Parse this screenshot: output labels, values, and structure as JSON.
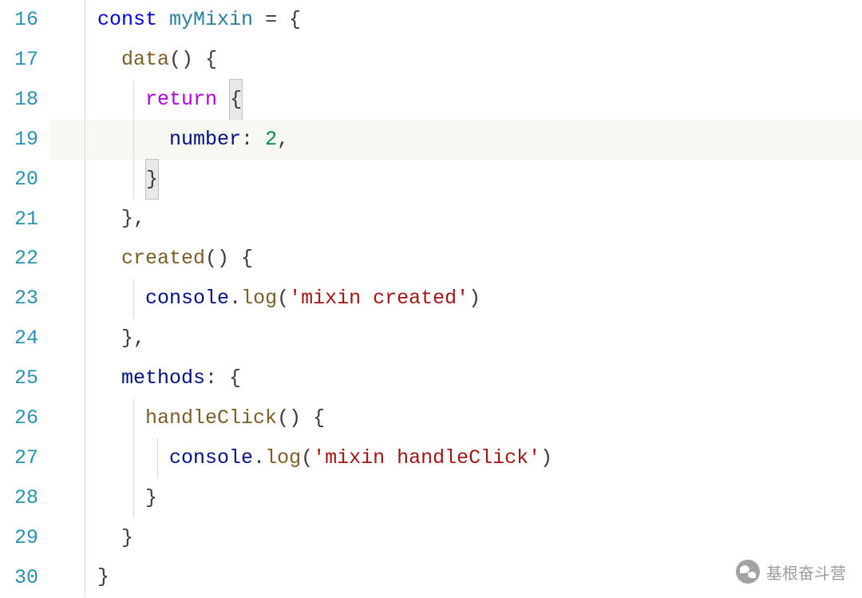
{
  "lineNumbers": [
    "16",
    "17",
    "18",
    "19",
    "20",
    "21",
    "22",
    "23",
    "24",
    "25",
    "26",
    "27",
    "28",
    "29",
    "30"
  ],
  "code": {
    "l16": {
      "kw": "const",
      "name": "myMixin",
      "op": "=",
      "brace": "{"
    },
    "l17": {
      "fn": "data",
      "parens": "()",
      "brace": "{"
    },
    "l18": {
      "kw": "return",
      "brace": "{"
    },
    "l19": {
      "prop": "number",
      "colon": ":",
      "val": "2",
      "comma": ","
    },
    "l20": {
      "brace": "}"
    },
    "l21": {
      "brace": "}",
      "comma": ","
    },
    "l22": {
      "fn": "created",
      "parens": "()",
      "brace": "{"
    },
    "l23": {
      "obj": "console",
      "dot": ".",
      "method": "log",
      "paren1": "(",
      "str": "'mixin created'",
      "paren2": ")"
    },
    "l24": {
      "brace": "}",
      "comma": ","
    },
    "l25": {
      "prop": "methods",
      "colon": ":",
      "brace": "{"
    },
    "l26": {
      "fn": "handleClick",
      "parens": "()",
      "brace": "{"
    },
    "l27": {
      "obj": "console",
      "dot": ".",
      "method": "log",
      "paren1": "(",
      "str": "'mixin handleClick'",
      "paren2": ")"
    },
    "l28": {
      "brace": "}"
    },
    "l29": {
      "brace": "}"
    },
    "l30": {
      "brace": "}"
    }
  },
  "watermark": {
    "text": "基根奋斗营"
  },
  "indent": {
    "i1": "    ",
    "i2": "      ",
    "i3": "        ",
    "i4": "          ",
    "i5": "            "
  }
}
